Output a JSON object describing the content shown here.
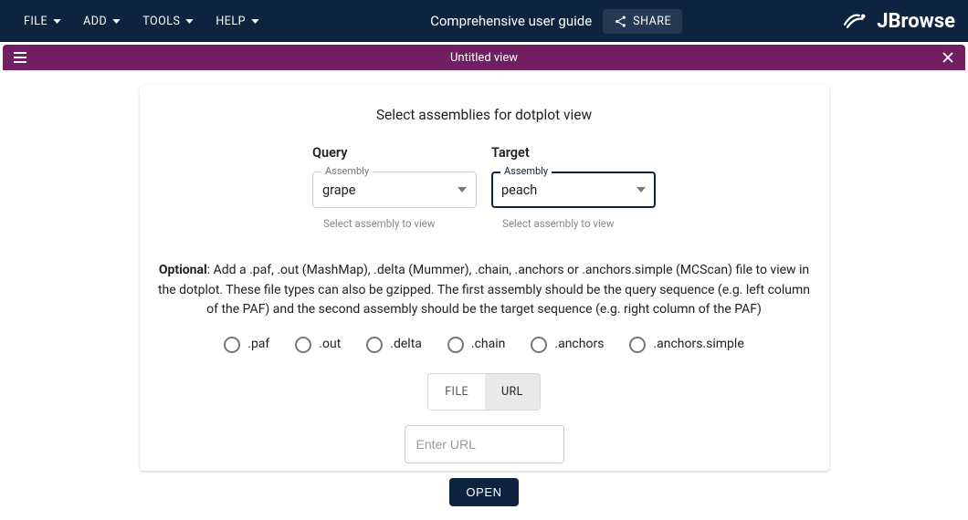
{
  "topbar": {
    "menus": {
      "file": "FILE",
      "add": "ADD",
      "tools": "TOOLS",
      "help": "HELP"
    },
    "title": "Comprehensive user guide",
    "share_label": "SHARE",
    "brand_text": "JBrowse"
  },
  "view": {
    "title": "Untitled view"
  },
  "panel": {
    "heading": "Select assemblies for dotplot view",
    "query": {
      "label": "Query",
      "float": "Assembly",
      "value": "grape",
      "helper": "Select assembly to view"
    },
    "target": {
      "label": "Target",
      "float": "Assembly",
      "value": "peach",
      "helper": "Select assembly to view"
    }
  },
  "lower": {
    "optional_label": "Optional",
    "text": ": Add a .paf, .out (MashMap), .delta (Mummer), .chain, .anchors or .anchors.simple (MCScan) file to view in the dotplot. These file types can also be gzipped. The first assembly should be the query sequence (e.g. left column of the PAF) and the second assembly should be the target sequence (e.g. right column of the PAF)",
    "radios": [
      ".paf",
      ".out",
      ".delta",
      ".chain",
      ".anchors",
      ".anchors.simple"
    ],
    "tabs": {
      "file": "FILE",
      "url": "URL",
      "selected": "url"
    },
    "url_placeholder": "Enter URL",
    "open_label": "OPEN"
  }
}
